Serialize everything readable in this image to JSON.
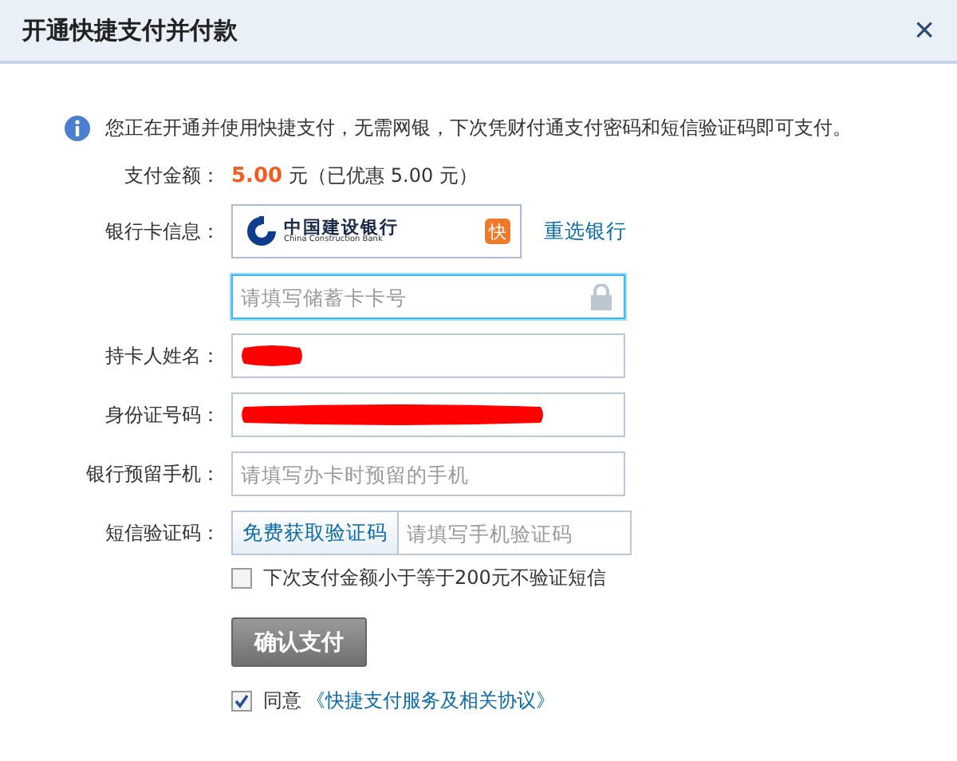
{
  "window": {
    "title": "开通快捷支付并付款",
    "close": "×"
  },
  "notice": "您正在开通并使用快捷支付，无需网银，下次凭财付通支付密码和短信验证码即可支付。",
  "amount": {
    "label": "支付金额：",
    "value": "5.00",
    "unit": "元",
    "discount": "（已优惠 5.00 元）"
  },
  "bank": {
    "label": "银行卡信息：",
    "name": "中国建设银行",
    "name_en": "China Construction Bank",
    "badge": "快",
    "reselect": "重选银行"
  },
  "fields": [
    {
      "kind": "secure",
      "placeholder": "请填写储蓄卡卡号",
      "focused": true
    },
    {
      "kind": "text",
      "label": "持卡人姓名：",
      "focused": false,
      "redacted": true,
      "level": 0.17
    },
    {
      "kind": "text",
      "label": "身份证号码：",
      "focused": false,
      "redacted": true,
      "level": 0.79
    },
    {
      "kind": "text",
      "label": "银行预留手机：",
      "placeholder": "请填写办卡时预留的手机",
      "focused": false
    },
    {
      "kind": "sms",
      "label": "短信验证码：",
      "button": "免费获取验证码",
      "placeholder": "请填写手机验证码",
      "focused": false
    }
  ],
  "skip_sms": {
    "label": "下次支付金额小于等于200元不验证短信",
    "checked": false
  },
  "submit": "确认支付",
  "agree": {
    "label": "同意",
    "link": "《快捷支付服务及相关协议》",
    "checked": true
  }
}
